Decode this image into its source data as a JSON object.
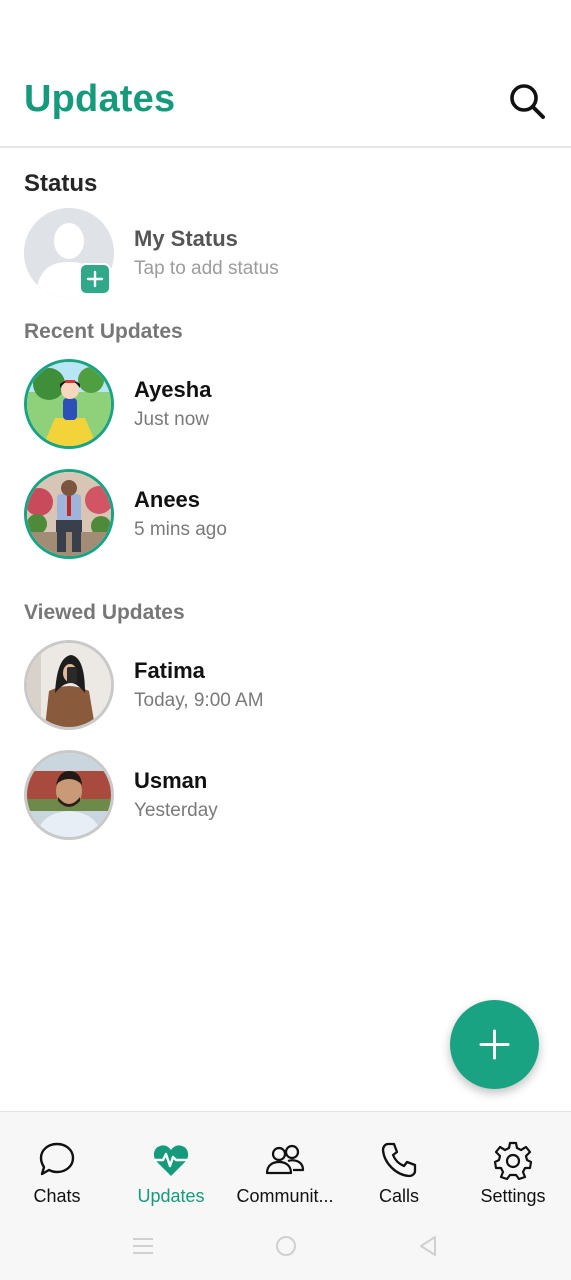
{
  "header": {
    "title": "Updates",
    "search_icon": "search-icon"
  },
  "status": {
    "title": "Status",
    "my_status": {
      "name": "My Status",
      "subtitle": "Tap to add status"
    }
  },
  "recent": {
    "title": "Recent Updates",
    "items": [
      {
        "name": "Ayesha",
        "time": "Just now"
      },
      {
        "name": "Anees",
        "time": "5 mins ago"
      }
    ]
  },
  "viewed": {
    "title": "Viewed Updates",
    "items": [
      {
        "name": "Fatima",
        "time": "Today, 9:00 AM"
      },
      {
        "name": "Usman",
        "time": "Yesterday"
      }
    ]
  },
  "nav": {
    "items": [
      {
        "label": "Chats",
        "icon": "chat-bubble-icon"
      },
      {
        "label": "Updates",
        "icon": "heartbeat-icon",
        "active": true
      },
      {
        "label": "Communit...",
        "icon": "community-icon"
      },
      {
        "label": "Calls",
        "icon": "phone-icon"
      },
      {
        "label": "Settings",
        "icon": "gear-icon"
      }
    ]
  },
  "colors": {
    "accent": "#169a7c",
    "fab": "#1aa383",
    "unseen_ring": "#1aa383",
    "seen_ring": "#c9c9c9"
  }
}
